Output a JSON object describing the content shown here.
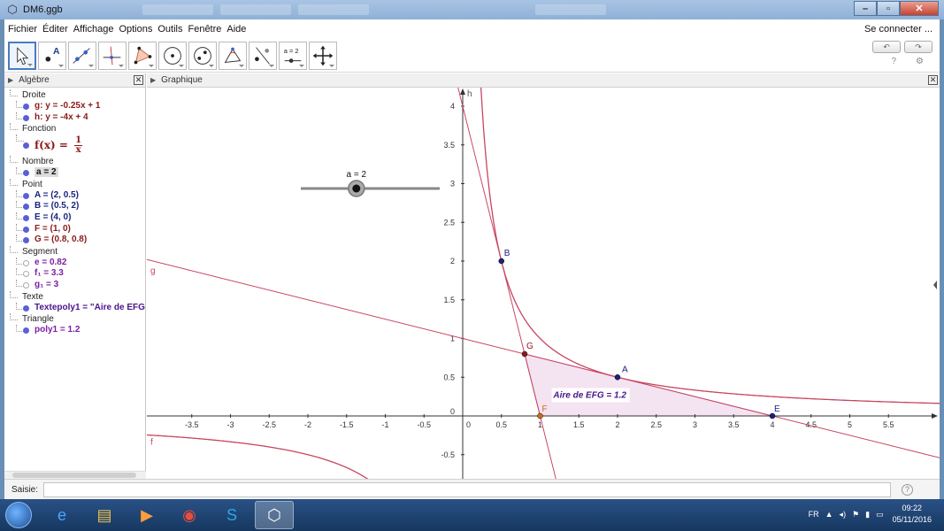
{
  "window": {
    "title": "DM6.ggb"
  },
  "menu": {
    "items": [
      "Fichier",
      "Éditer",
      "Affichage",
      "Options",
      "Outils",
      "Fenêtre",
      "Aide"
    ],
    "connect": "Se connecter ..."
  },
  "toolbar": {
    "tools": [
      {
        "name": "move-tool",
        "icon": "cursor-arrow-icon"
      },
      {
        "name": "point-tool",
        "icon": "point-icon",
        "label": "A"
      },
      {
        "name": "line-tool",
        "icon": "line-icon"
      },
      {
        "name": "perpendicular-tool",
        "icon": "perpendicular-icon"
      },
      {
        "name": "polygon-tool",
        "icon": "polygon-icon"
      },
      {
        "name": "circle-tool",
        "icon": "circle-icon"
      },
      {
        "name": "conic-tool",
        "icon": "ellipse-icon"
      },
      {
        "name": "angle-tool",
        "icon": "angle-icon"
      },
      {
        "name": "reflect-tool",
        "icon": "reflect-icon"
      },
      {
        "name": "slider-tool",
        "icon": "slider-icon",
        "label": "a = 2"
      },
      {
        "name": "move-view-tool",
        "icon": "move-cross-icon"
      }
    ]
  },
  "algebra": {
    "title": "Algèbre",
    "groups": [
      {
        "label": "Droite",
        "items": [
          {
            "text": "g: y = -0.25x + 1",
            "color": "#8b1a1a"
          },
          {
            "text": "h: y = -4x + 4",
            "color": "#8b1a1a"
          }
        ]
      },
      {
        "label": "Fonction",
        "items": [
          {
            "text": "f(x) = ",
            "num": "1",
            "den": "x",
            "color": "#8b1a1a",
            "kind": "fraction"
          }
        ]
      },
      {
        "label": "Nombre",
        "items": [
          {
            "text": "a = 2",
            "color": "#111",
            "selected": true
          }
        ]
      },
      {
        "label": "Point",
        "items": [
          {
            "text": "A = (2, 0.5)",
            "color": "#1a237e"
          },
          {
            "text": "B = (0.5, 2)",
            "color": "#1a237e"
          },
          {
            "text": "E = (4, 0)",
            "color": "#1a237e"
          },
          {
            "text": "F = (1, 0)",
            "color": "#8b1a1a"
          },
          {
            "text": "G = (0.8, 0.8)",
            "color": "#8b1a1a"
          }
        ]
      },
      {
        "label": "Segment",
        "items": [
          {
            "text": "e = 0.82",
            "color": "#7b1fa2",
            "hollow": true
          },
          {
            "text": "f₁ = 3.3",
            "color": "#7b1fa2",
            "hollow": true
          },
          {
            "text": "g₁ = 3",
            "color": "#7b1fa2",
            "hollow": true
          }
        ]
      },
      {
        "label": "Texte",
        "items": [
          {
            "text": "Textepoly1 = \"Aire de  EFG = ",
            "color": "#4a148c"
          }
        ]
      },
      {
        "label": "Triangle",
        "items": [
          {
            "text": "poly1 = 1.2",
            "color": "#7b1fa2"
          }
        ]
      }
    ]
  },
  "graphics": {
    "title": "Graphique",
    "slider": {
      "label": "a = 2",
      "min": 0,
      "max": 5,
      "value": 2
    },
    "x_ticks": [
      "-3.5",
      "-3",
      "-2.5",
      "-2",
      "-1.5",
      "-1",
      "-0.5",
      "0",
      "0.5",
      "1",
      "1.5",
      "2",
      "2.5",
      "3",
      "3.5",
      "4",
      "4.5",
      "5",
      "5.5"
    ],
    "y_ticks": [
      "-0.5",
      "0",
      "0.5",
      "1",
      "1.5",
      "2",
      "2.5",
      "3",
      "3.5",
      "4"
    ],
    "points": [
      {
        "name": "A",
        "x": 2,
        "y": 0.5,
        "color": "#1a237e"
      },
      {
        "name": "B",
        "x": 0.5,
        "y": 2,
        "color": "#1a237e"
      },
      {
        "name": "E",
        "x": 4,
        "y": 0,
        "color": "#1a237e"
      },
      {
        "name": "F",
        "x": 1,
        "y": 0,
        "color": "#d2691e"
      },
      {
        "name": "G",
        "x": 0.8,
        "y": 0.8,
        "color": "#8b1a1a"
      }
    ],
    "curve_labels": {
      "g": "g",
      "h": "h",
      "f": "f"
    },
    "area_text": "Aire de  EFG = 1.2",
    "colors": {
      "curve": "#c94460",
      "triangle_fill": "#f4e3f1",
      "axis": "#333"
    }
  },
  "input": {
    "label": "Saisie:"
  },
  "taskbar": {
    "lang": "FR",
    "time": "09:22",
    "date": "05/11/2016",
    "apps": [
      "ie-icon",
      "explorer-icon",
      "media-player-icon",
      "chrome-icon",
      "skype-icon",
      "geogebra-icon"
    ]
  }
}
